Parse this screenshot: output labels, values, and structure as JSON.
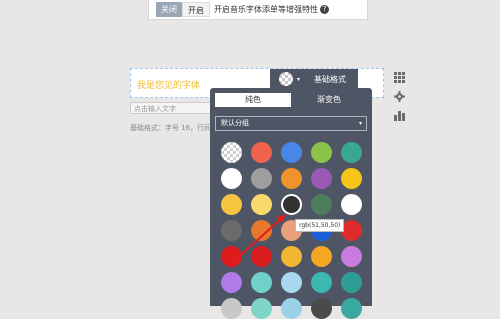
{
  "top_bar": {
    "close_label": "关闭",
    "open_label": "开启",
    "description": "开启音乐字体添单等增强特性",
    "help_icon": "?"
  },
  "editor": {
    "text": "我是您见的字体",
    "hint_placeholder": "点击输入文字",
    "meta": "基础格式：字号 16，行间距"
  },
  "style_toolbar": {
    "caret": "▾",
    "base_style_label": "基础格式"
  },
  "side_icons": [
    "grid-icon",
    "settings-icon",
    "chart-icon"
  ],
  "color_panel": {
    "tabs": [
      {
        "label": "纯色",
        "active": true
      },
      {
        "label": "渐变色",
        "active": false
      }
    ],
    "group_select": {
      "value": "默认分组",
      "arrow": "▾"
    },
    "swatches": [
      [
        "transparent",
        "#f0624d",
        "#4a86e8",
        "#8bc34a",
        "#3aa88f"
      ],
      [
        "#ffffff",
        "#9e9e9e",
        "#f0932b",
        "#9b59b6",
        "#f5c518"
      ],
      [
        "#f5c542",
        "#f7d86a",
        "#323232",
        "#4e7d5b",
        "#ffffff"
      ],
      [
        "#6b6b6b",
        "#e8772e",
        "#e8a07a",
        "#1a5fd6",
        "#e02b2b"
      ],
      [
        "#e01b1b",
        "#d81e1e",
        "#f2b630",
        "#f5a623",
        "#c77de0"
      ],
      [
        "#b07be8",
        "#6fd1c7",
        "#a7d8f0",
        "#3cb8b0",
        "#2e9e95"
      ],
      [
        "#c8c8c8",
        "#7fd4c8",
        "#9ad0e8",
        "#4a4a4a",
        "#3aa8a0"
      ]
    ],
    "selected_index": [
      2,
      2
    ],
    "tooltip": "rgb(51,50,50)"
  },
  "colors": {
    "panel_bg": "#4e5666",
    "accent_arrow": "#e02020"
  }
}
